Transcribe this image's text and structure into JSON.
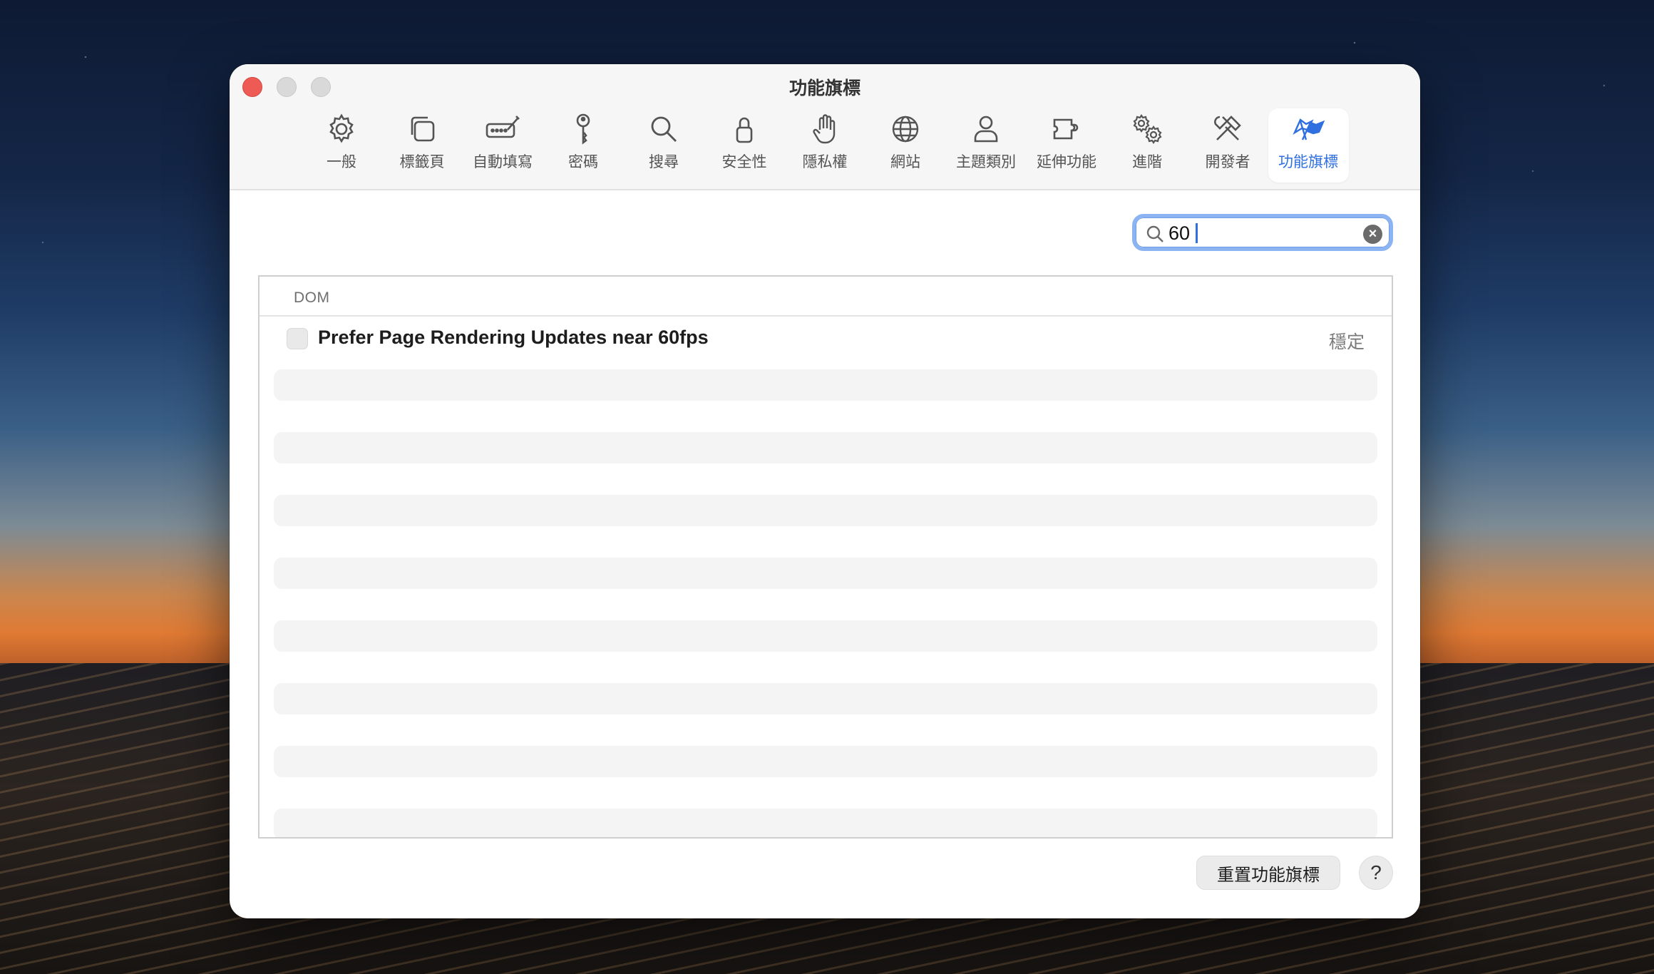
{
  "window": {
    "title": "功能旗標"
  },
  "tabs": [
    {
      "label": "一般",
      "icon": "gear-icon"
    },
    {
      "label": "標籤頁",
      "icon": "tabs-icon"
    },
    {
      "label": "自動填寫",
      "icon": "autofill-icon"
    },
    {
      "label": "密碼",
      "icon": "key-icon"
    },
    {
      "label": "搜尋",
      "icon": "search-icon"
    },
    {
      "label": "安全性",
      "icon": "lock-icon"
    },
    {
      "label": "隱私權",
      "icon": "hand-icon"
    },
    {
      "label": "網站",
      "icon": "globe-icon"
    },
    {
      "label": "主題類別",
      "icon": "person-icon"
    },
    {
      "label": "延伸功能",
      "icon": "puzzle-icon"
    },
    {
      "label": "進階",
      "icon": "gears-icon"
    },
    {
      "label": "開發者",
      "icon": "tools-icon"
    },
    {
      "label": "功能旗標",
      "icon": "flags-icon",
      "active": true
    }
  ],
  "search": {
    "value": "60"
  },
  "list": {
    "section": "DOM",
    "flags": [
      {
        "title": "Prefer Page Rendering Updates near 60fps",
        "status": "穩定",
        "checked": false
      }
    ]
  },
  "footer": {
    "reset_label": "重置功能旗標",
    "help_label": "?"
  },
  "colors": {
    "accent": "#2f6fe0",
    "close": "#ee5b54"
  }
}
